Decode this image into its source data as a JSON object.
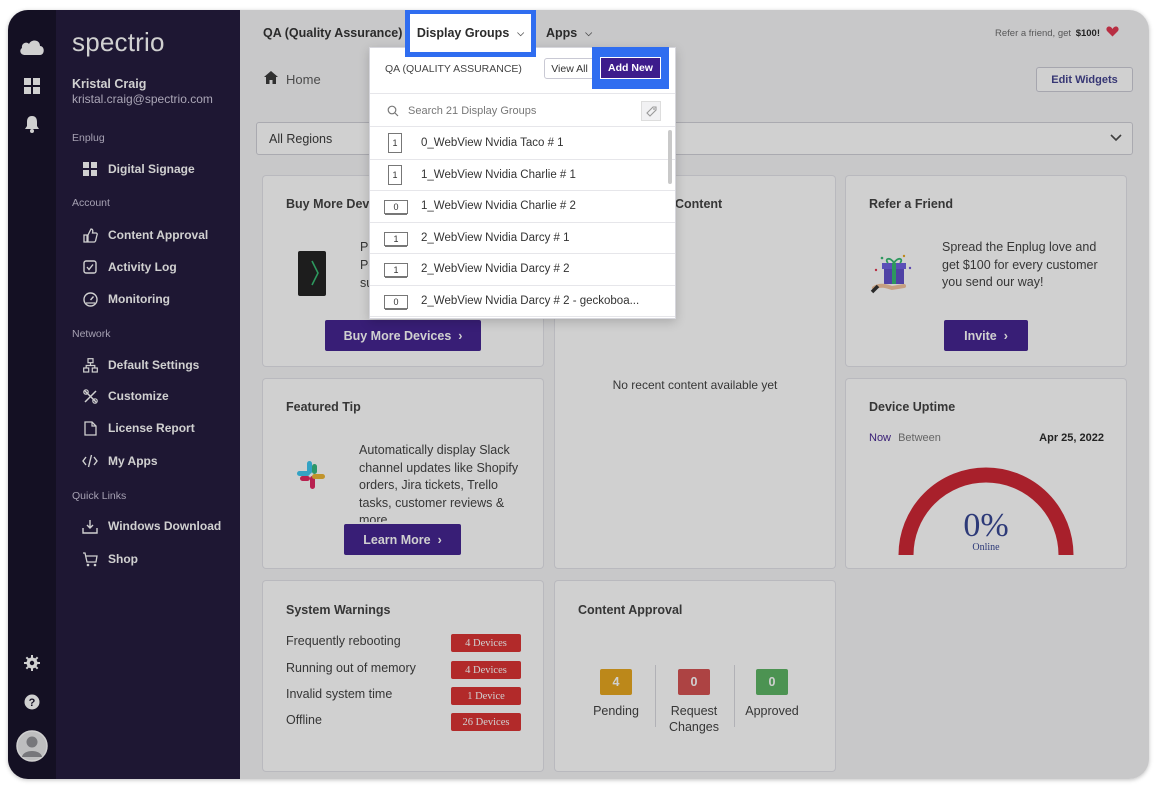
{
  "brand": {
    "logo_text": "spectrio"
  },
  "user": {
    "name": "Kristal Craig",
    "email": "kristal.craig@spectrio.com"
  },
  "sidebar": {
    "sections": [
      {
        "heading": "Enplug",
        "items": [
          {
            "label": "Digital Signage",
            "icon": "grid-icon"
          }
        ]
      },
      {
        "heading": "Account",
        "items": [
          {
            "label": "Content Approval",
            "icon": "thumbs-up-icon"
          },
          {
            "label": "Activity Log",
            "icon": "checkbox-icon"
          },
          {
            "label": "Monitoring",
            "icon": "gauge-icon"
          }
        ]
      },
      {
        "heading": "Network",
        "items": [
          {
            "label": "Default Settings",
            "icon": "network-icon"
          },
          {
            "label": "Customize",
            "icon": "tools-icon"
          },
          {
            "label": "License Report",
            "icon": "file-icon"
          },
          {
            "label": "My Apps",
            "icon": "code-icon"
          }
        ]
      },
      {
        "heading": "Quick Links",
        "items": [
          {
            "label": "Windows Download",
            "icon": "download-icon"
          },
          {
            "label": "Shop",
            "icon": "cart-icon"
          }
        ]
      }
    ]
  },
  "topbar": {
    "org": "QA (Quality Assurance)",
    "display_groups": "Display Groups",
    "apps": "Apps",
    "refer_text": "Refer a friend, get",
    "refer_amount": "$100!"
  },
  "breadcrumb": {
    "home": "Home"
  },
  "edit_widgets": "Edit Widgets",
  "region": {
    "selected": "All Regions"
  },
  "dropdown": {
    "header": "QA (QUALITY ASSURANCE)",
    "view_all": "View All",
    "add_new": "Add New",
    "search_placeholder": "Search 21 Display Groups",
    "groups": [
      {
        "count": "1",
        "name": "0_WebView Nvidia Taco # 1",
        "orientation": "portrait"
      },
      {
        "count": "1",
        "name": "1_WebView Nvidia Charlie # 1",
        "orientation": "portrait"
      },
      {
        "count": "0",
        "name": "1_WebView Nvidia Charlie # 2",
        "orientation": "landscape"
      },
      {
        "count": "1",
        "name": "2_WebView Nvidia Darcy # 1",
        "orientation": "landscape"
      },
      {
        "count": "1",
        "name": "2_WebView Nvidia Darcy # 2",
        "orientation": "landscape"
      },
      {
        "count": "0",
        "name": "2_WebView Nvidia Darcy # 2 - geckoboa...",
        "orientation": "landscape"
      }
    ]
  },
  "cards": {
    "buy_devices": {
      "title": "Buy More Devi",
      "text_lines": [
        "Pu",
        "Pe",
        "su"
      ],
      "button": "Buy More Devices"
    },
    "recent_content": {
      "title": "Content",
      "empty": "No recent content available yet"
    },
    "refer": {
      "title": "Refer a Friend",
      "text": "Spread the Enplug love and get $100 for every customer you send our way!",
      "button": "Invite"
    },
    "featured_tip": {
      "title": "Featured Tip",
      "text": "Automatically display Slack channel updates like Shopify orders, Jira tickets, Trello tasks, customer reviews & more",
      "button": "Learn More"
    },
    "uptime": {
      "title": "Device Uptime",
      "tab_now": "Now",
      "tab_between": "Between",
      "date": "Apr 25, 2022",
      "percent": "0%",
      "label": "Online",
      "value": 0
    },
    "warnings": {
      "title": "System Warnings",
      "rows": [
        {
          "label": "Frequently rebooting",
          "badge": "4 Devices"
        },
        {
          "label": "Running out of memory",
          "badge": "4 Devices"
        },
        {
          "label": "Invalid system time",
          "badge": "1 Device"
        },
        {
          "label": "Offline",
          "badge": "26 Devices"
        }
      ]
    },
    "approval": {
      "title": "Content Approval",
      "cols": [
        {
          "count": "4",
          "label": "Pending",
          "color": "#e6a317"
        },
        {
          "count": "0",
          "label": "Request Changes",
          "color": "#d34b4b"
        },
        {
          "count": "0",
          "label": "Approved",
          "color": "#56b15e"
        }
      ]
    }
  },
  "colors": {
    "accent": "#3d1c8c",
    "highlight": "#2f6df0",
    "danger": "#d92b2b",
    "gauge": "#cc1e2c"
  }
}
